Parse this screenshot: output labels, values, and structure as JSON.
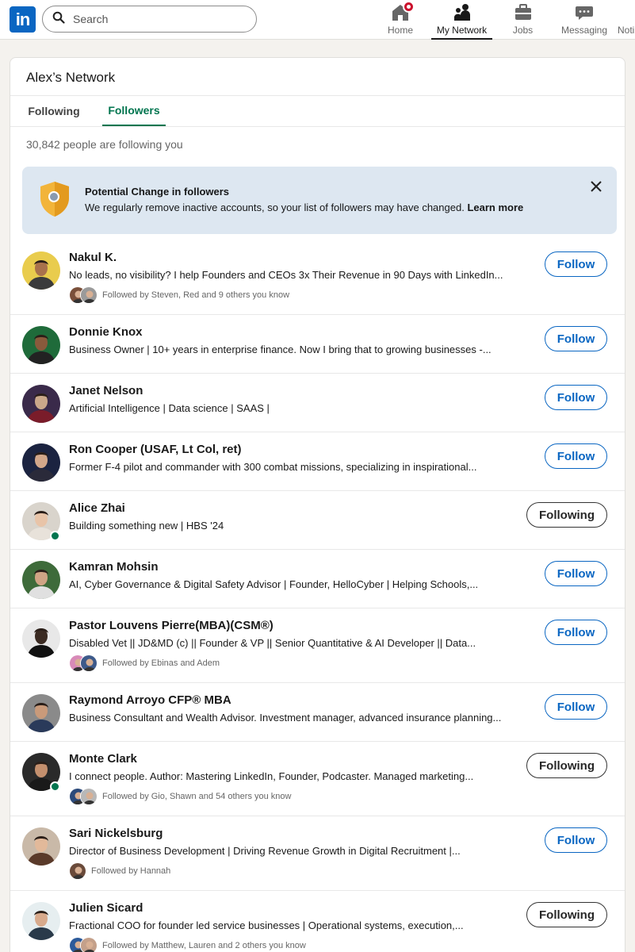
{
  "nav": {
    "logo": "in",
    "search_placeholder": "Search",
    "items": [
      {
        "label": "Home",
        "icon": "home-icon"
      },
      {
        "label": "My Network",
        "icon": "network-icon",
        "active": true
      },
      {
        "label": "Jobs",
        "icon": "briefcase-icon"
      },
      {
        "label": "Messaging",
        "icon": "messaging-icon"
      },
      {
        "label": "Noti",
        "icon": "bell-icon"
      }
    ]
  },
  "page": {
    "title": "Alex’s Network",
    "tabs": [
      "Following",
      "Followers"
    ],
    "active_tab": "Followers",
    "count": "30,842 people are following you"
  },
  "notice": {
    "title": "Potential Change in followers",
    "text": "We regularly remove inactive accounts, so your list of followers may have changed.",
    "link": "Learn more"
  },
  "followers": [
    {
      "name": "Nakul K.",
      "headline": "No leads, no visibility? I help Founders and CEOs 3x Their Revenue in 90 Days with LinkedIn...",
      "mutual": "Followed by Steven, Red and 9 others you know",
      "button": "Follow",
      "online": false,
      "avatar_bg": "#e9cc4d",
      "skin": "#a9714c",
      "shirt": "#3b3b3b",
      "faces": [
        "#7a4f3a",
        "#9a9a9a"
      ]
    },
    {
      "name": "Donnie Knox",
      "headline": "Business Owner | 10+ years in enterprise finance. Now I bring that to growing businesses -...",
      "mutual": "",
      "button": "Follow",
      "online": false,
      "avatar_bg": "#1f6b3a",
      "skin": "#8a5a3c",
      "shirt": "#222",
      "faces": []
    },
    {
      "name": "Janet Nelson",
      "headline": "Artificial Intelligence | Data science | SAAS |",
      "mutual": "",
      "button": "Follow",
      "online": false,
      "avatar_bg": "#3a2a4a",
      "skin": "#caa88a",
      "shirt": "#7a1c2a",
      "faces": []
    },
    {
      "name": "Ron Cooper (USAF, Lt Col, ret)",
      "headline": "Former F-4 pilot and commander with 300 combat missions, specializing in inspirational...",
      "mutual": "",
      "button": "Follow",
      "online": false,
      "avatar_bg": "#1b2340",
      "skin": "#d2a78a",
      "shirt": "#2a2a3a",
      "faces": []
    },
    {
      "name": "Alice Zhai",
      "headline": "Building something new | HBS '24",
      "mutual": "",
      "button": "Following",
      "online": true,
      "avatar_bg": "#d9d4cc",
      "skin": "#e8c4a8",
      "shirt": "#e8e2da",
      "faces": []
    },
    {
      "name": "Kamran Mohsin",
      "headline": "AI, Cyber Governance & Digital Safety Advisor | Founder, HelloCyber | Helping Schools,...",
      "mutual": "",
      "button": "Follow",
      "online": false,
      "avatar_bg": "#3e6b3a",
      "skin": "#d0a485",
      "shirt": "#e0e0e0",
      "faces": []
    },
    {
      "name": "Pastor Louvens Pierre(MBA)(CSM®)",
      "headline": "Disabled Vet || JD&MD (c) || Founder & VP || Senior Quantitative & AI Developer || Data...",
      "mutual": "Followed by Ebinas and Adem",
      "button": "Follow",
      "online": false,
      "avatar_bg": "#e8e8e8",
      "skin": "#3a2a22",
      "shirt": "#111",
      "faces": [
        "#d88ab8",
        "#3d5a8a"
      ]
    },
    {
      "name": "Raymond Arroyo CFP® MBA",
      "headline": "Business Consultant and Wealth Advisor. Investment manager, advanced insurance planning...",
      "mutual": "",
      "button": "Follow",
      "online": false,
      "avatar_bg": "#8a8a8a",
      "skin": "#c99a7a",
      "shirt": "#2a3a5a",
      "faces": []
    },
    {
      "name": "Monte Clark",
      "headline": "I connect people. Author: Mastering LinkedIn, Founder, Podcaster. Managed marketing...",
      "mutual": "Followed by Gio, Shawn and 54 others you know",
      "button": "Following",
      "online": true,
      "avatar_bg": "#2a2a2a",
      "skin": "#c4906e",
      "shirt": "#1a1a1a",
      "faces": [
        "#2c4a7a",
        "#b8b8b8"
      ]
    },
    {
      "name": "Sari Nickelsburg",
      "headline": "Director of Business Development | Driving Revenue Growth in Digital Recruitment |...",
      "mutual": "Followed by Hannah",
      "button": "Follow",
      "online": false,
      "avatar_bg": "#c9b9a8",
      "skin": "#e2b99a",
      "shirt": "#5a3a2a",
      "faces": [
        "#6a4a3a"
      ]
    },
    {
      "name": "Julien Sicard",
      "headline": "Fractional COO for founder led service businesses | Operational systems, execution,...",
      "mutual": "Followed by Matthew, Lauren and 2 others you know",
      "button": "Following",
      "online": false,
      "avatar_bg": "#e6eef0",
      "skin": "#d8aa8c",
      "shirt": "#2a3a4a",
      "faces": [
        "#2c5a9a",
        "#c4a08a"
      ]
    }
  ]
}
